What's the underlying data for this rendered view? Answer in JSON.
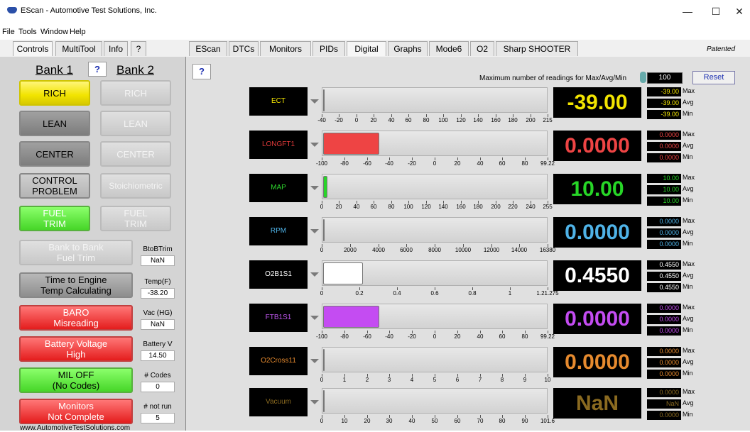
{
  "window": {
    "title": "EScan - Automotive Test Solutions, Inc.",
    "minimize": "—",
    "maximize": "☐",
    "close": "✕"
  },
  "menu": [
    "File",
    "Tools",
    "Window",
    "Help"
  ],
  "left_tabs": [
    "Controls",
    "MultiTool",
    "Info",
    "?"
  ],
  "right_tabs": [
    "EScan",
    "DTCs",
    "Monitors",
    "PIDs",
    "Digital",
    "Graphs",
    "Mode6",
    "O2",
    "Sharp SHOOTER"
  ],
  "patented": "Patented",
  "bank": {
    "bank1": "Bank 1",
    "bank2": "Bank 2",
    "help": "?"
  },
  "indicators": {
    "rich1": "RICH",
    "rich2": "RICH",
    "lean1": "LEAN",
    "lean2": "LEAN",
    "center1": "CENTER",
    "center2": "CENTER",
    "control_problem_l1": "CONTROL",
    "control_problem_l2": "PROBLEM",
    "stoich": "Stoichiometric",
    "fueltrim1_l1": "FUEL",
    "fueltrim1_l2": "TRIM",
    "fueltrim2_l1": "FUEL",
    "fueltrim2_l2": "TRIM",
    "btob_l1": "Bank to Bank",
    "btob_l2": "Fuel Trim",
    "tte_l1": "Time to Engine",
    "tte_l2": "Temp Calculating",
    "baro_l1": "BARO",
    "baro_l2": "Misreading",
    "batt_l1": "Battery Voltage",
    "batt_l2": "High",
    "mil_l1": "MIL OFF",
    "mil_l2": "(No Codes)",
    "mon_l1": "Monitors",
    "mon_l2": "Not Complete"
  },
  "side": {
    "btob_label": "BtoBTrim",
    "btob_val": "NaN",
    "temp_label": "Temp(F)",
    "temp_val": "-38.20",
    "vac_label": "Vac (HG)",
    "vac_val": "NaN",
    "batt_label": "Battery V",
    "batt_val": "14.50",
    "codes_label": "# Codes",
    "codes_val": "0",
    "notrun_label": "# not run",
    "notrun_val": "5"
  },
  "url": "www.AutomotiveTestSolutions.com",
  "digital": {
    "help": "?",
    "maxavg_label": "Maximum number of readings for Max/Avg/Min",
    "maxavg_value": "100",
    "reset": "Reset",
    "stat_labels": {
      "max": "Max",
      "avg": "Avg",
      "min": "Min"
    }
  },
  "gauges": [
    {
      "name": "ECT",
      "name_color": "#f2e400",
      "color": "#f2e400",
      "value": "-39.00",
      "max": "-39.00",
      "avg": "-39.00",
      "min": "-39.00",
      "fill": 0.003,
      "ticks": [
        "-40",
        "-20",
        "0",
        "20",
        "40",
        "60",
        "80",
        "100",
        "120",
        "140",
        "160",
        "180",
        "200",
        "215"
      ]
    },
    {
      "name": "LONGFT1",
      "name_color": "#e23a3a",
      "color": "#ee4444",
      "value": "0.0000",
      "max": "0.0000",
      "avg": "0.0000",
      "min": "0.0000",
      "fill": 0.502,
      "ticks": [
        "-100",
        "-80",
        "-60",
        "-40",
        "-20",
        "0",
        "20",
        "40",
        "60",
        "80",
        "99.22"
      ]
    },
    {
      "name": "MAP",
      "name_color": "#2ed62e",
      "color": "#27d627",
      "value": "10.00",
      "max": "10.00",
      "avg": "10.00",
      "min": "10.00",
      "fill": 0.039,
      "ticks": [
        "0",
        "20",
        "40",
        "60",
        "80",
        "100",
        "120",
        "140",
        "160",
        "180",
        "200",
        "220",
        "240",
        "255"
      ]
    },
    {
      "name": "RPM",
      "name_color": "#4fb3e8",
      "color": "#4fb3e8",
      "value": "0.0000",
      "max": "0.0000",
      "avg": "0.0000",
      "min": "0.0000",
      "fill": 0.003,
      "ticks": [
        "0",
        "2000",
        "4000",
        "6000",
        "8000",
        "10000",
        "12000",
        "14000",
        "16380"
      ]
    },
    {
      "name": "O2B1S1",
      "name_color": "#ffffff",
      "color": "#ffffff",
      "value": "0.4550",
      "max": "0.4550",
      "avg": "0.4550",
      "min": "0.4550",
      "fill": 0.357,
      "ticks": [
        "0",
        "0.2",
        "0.4",
        "0.6",
        "0.8",
        "1",
        "1.21.275"
      ]
    },
    {
      "name": "FTB1S1",
      "name_color": "#c057f0",
      "color": "#c44cf2",
      "value": "0.0000",
      "max": "0.0000",
      "avg": "0.0000",
      "min": "0.0000",
      "fill": 0.502,
      "ticks": [
        "-100",
        "-80",
        "-60",
        "-40",
        "-20",
        "0",
        "20",
        "40",
        "60",
        "80",
        "99.22"
      ]
    },
    {
      "name": "O2Cross11",
      "name_color": "#e68a2e",
      "color": "#e68a2e",
      "value": "0.0000",
      "max": "0.0000",
      "avg": "0.0000",
      "min": "0.0000",
      "fill": 0.003,
      "ticks": [
        "0",
        "1",
        "2",
        "3",
        "4",
        "5",
        "6",
        "7",
        "8",
        "9",
        "10"
      ]
    },
    {
      "name": "Vacuum",
      "name_color": "#8a6a20",
      "color": "#8a6a20",
      "value": "NaN",
      "max": "0.0000",
      "avg": "NaN",
      "min": "0.0000",
      "fill": 0.003,
      "ticks": [
        "0",
        "10",
        "20",
        "30",
        "40",
        "50",
        "60",
        "70",
        "80",
        "90",
        "101.6"
      ]
    }
  ]
}
